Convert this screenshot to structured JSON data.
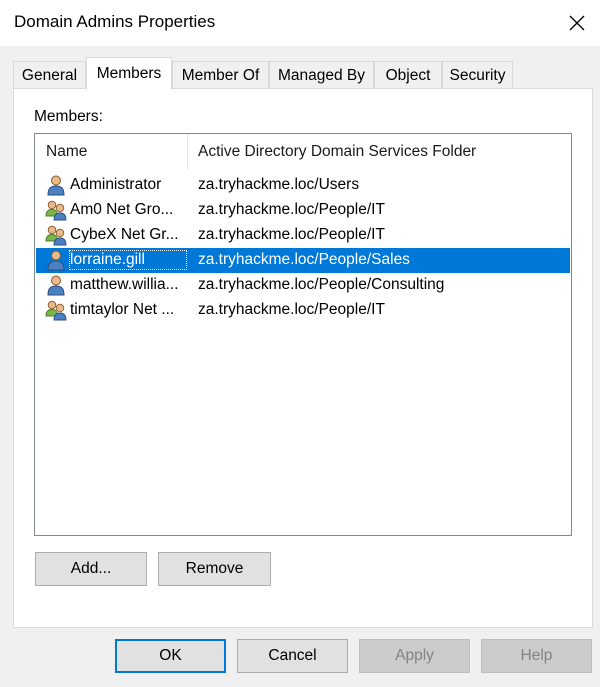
{
  "window": {
    "title": "Domain Admins Properties"
  },
  "tabs": [
    {
      "label": "General"
    },
    {
      "label": "Members"
    },
    {
      "label": "Member Of"
    },
    {
      "label": "Managed By"
    },
    {
      "label": "Object"
    },
    {
      "label": "Security"
    }
  ],
  "active_tab": "Members",
  "members": {
    "label": "Members:",
    "columns": [
      "Name",
      "Active Directory Domain Services Folder"
    ],
    "rows": [
      {
        "name": "Administrator",
        "folder": "za.tryhackme.loc/Users",
        "icon": "user-icon"
      },
      {
        "name": "Am0 Net Gro...",
        "folder": "za.tryhackme.loc/People/IT",
        "icon": "group-icon"
      },
      {
        "name": "CybeX Net Gr...",
        "folder": "za.tryhackme.loc/People/IT",
        "icon": "group-icon"
      },
      {
        "name": "lorraine.gill",
        "folder": "za.tryhackme.loc/People/Sales",
        "icon": "user-icon"
      },
      {
        "name": "matthew.willia...",
        "folder": "za.tryhackme.loc/People/Consulting",
        "icon": "user-icon"
      },
      {
        "name": "timtaylor Net ...",
        "folder": "za.tryhackme.loc/People/IT",
        "icon": "group-icon"
      }
    ],
    "selected_row": "lorraine.gill"
  },
  "buttons": {
    "add": "Add...",
    "remove": "Remove",
    "ok": "OK",
    "cancel": "Cancel",
    "apply": "Apply",
    "help": "Help"
  },
  "colors": {
    "selection": "#0078d7",
    "default_button_border": "#0078d7"
  }
}
